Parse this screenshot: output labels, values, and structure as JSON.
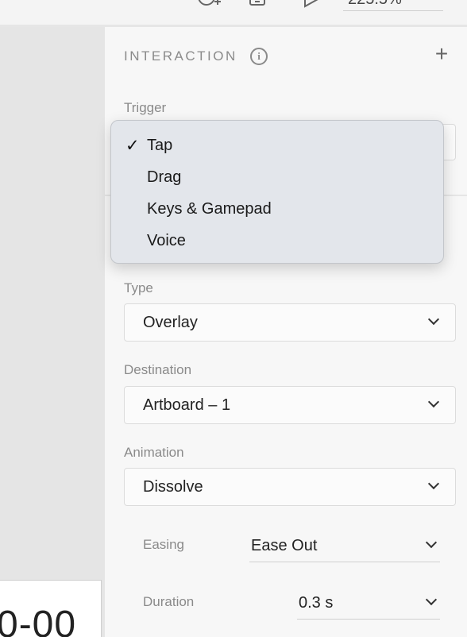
{
  "toolbar": {
    "icons": [
      "add-user-icon",
      "device-preview-icon",
      "play-icon"
    ],
    "zoom_value": "225.5%"
  },
  "canvas": {
    "artboard_text": "0-00"
  },
  "interaction": {
    "section_title": "INTERACTION",
    "trigger_label": "Trigger",
    "trigger_menu": {
      "selected": "Tap",
      "options": [
        "Tap",
        "Drag",
        "Keys & Gamepad",
        "Voice"
      ]
    },
    "type_label": "Type",
    "type_value": "Overlay",
    "destination_label": "Destination",
    "destination_value": "Artboard – 1",
    "animation_label": "Animation",
    "animation_value": "Dissolve",
    "easing_label": "Easing",
    "easing_value": "Ease Out",
    "duration_label": "Duration",
    "duration_value": "0.3 s"
  },
  "colors": {
    "panel_bg": "#f7f7f7",
    "canvas_bg": "#e5e5e5",
    "menu_bg": "#e3e6eb",
    "label_gray": "#8a8a8a"
  }
}
